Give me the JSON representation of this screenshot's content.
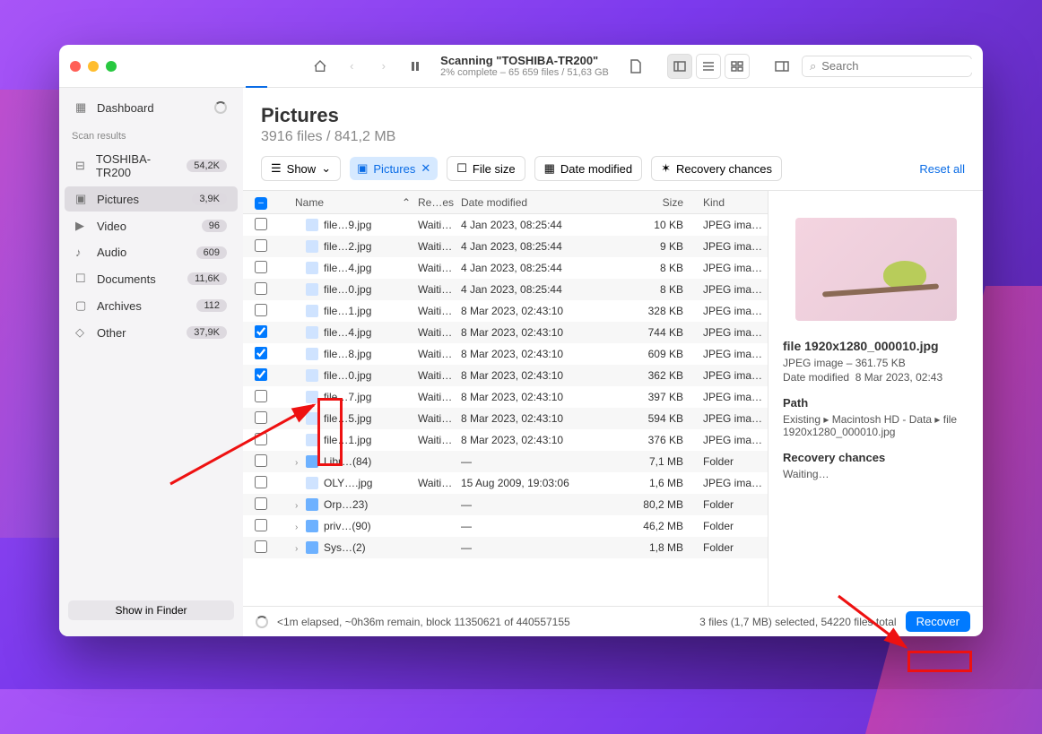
{
  "titlebar": {
    "scan_title": "Scanning \"TOSHIBA-TR200\"",
    "scan_sub": "2% complete – 65 659 files / 51,63 GB",
    "search_placeholder": "Search"
  },
  "sidebar": {
    "dashboard": "Dashboard",
    "section": "Scan results",
    "items": [
      {
        "label": "TOSHIBA-TR200",
        "count": "54,2K"
      },
      {
        "label": "Pictures",
        "count": "3,9K"
      },
      {
        "label": "Video",
        "count": "96"
      },
      {
        "label": "Audio",
        "count": "609"
      },
      {
        "label": "Documents",
        "count": "11,6K"
      },
      {
        "label": "Archives",
        "count": "112"
      },
      {
        "label": "Other",
        "count": "37,9K"
      }
    ],
    "show_in_finder": "Show in Finder"
  },
  "main": {
    "title": "Pictures",
    "subtitle": "3916 files / 841,2 MB",
    "show_btn": "Show",
    "filters": {
      "pictures": "Pictures",
      "file_size": "File size",
      "date_modified": "Date modified",
      "recovery_chances": "Recovery chances"
    },
    "reset": "Reset all"
  },
  "table": {
    "headers": {
      "name": "Name",
      "rec": "Re…es",
      "date": "Date modified",
      "size": "Size",
      "kind": "Kind"
    },
    "rows": [
      {
        "chk": false,
        "chev": false,
        "folder": false,
        "name": "file…9.jpg",
        "rec": "Waiti…",
        "date": "4 Jan 2023, 08:25:44",
        "size": "10 KB",
        "kind": "JPEG ima…"
      },
      {
        "chk": false,
        "chev": false,
        "folder": false,
        "name": "file…2.jpg",
        "rec": "Waiti…",
        "date": "4 Jan 2023, 08:25:44",
        "size": "9 KB",
        "kind": "JPEG ima…"
      },
      {
        "chk": false,
        "chev": false,
        "folder": false,
        "name": "file…4.jpg",
        "rec": "Waiti…",
        "date": "4 Jan 2023, 08:25:44",
        "size": "8 KB",
        "kind": "JPEG ima…"
      },
      {
        "chk": false,
        "chev": false,
        "folder": false,
        "name": "file…0.jpg",
        "rec": "Waiti…",
        "date": "4 Jan 2023, 08:25:44",
        "size": "8 KB",
        "kind": "JPEG ima…"
      },
      {
        "chk": false,
        "chev": false,
        "folder": false,
        "name": "file…1.jpg",
        "rec": "Waiti…",
        "date": "8 Mar 2023, 02:43:10",
        "size": "328 KB",
        "kind": "JPEG ima…"
      },
      {
        "chk": true,
        "chev": false,
        "folder": false,
        "name": "file…4.jpg",
        "rec": "Waiti…",
        "date": "8 Mar 2023, 02:43:10",
        "size": "744 KB",
        "kind": "JPEG ima…"
      },
      {
        "chk": true,
        "chev": false,
        "folder": false,
        "name": "file…8.jpg",
        "rec": "Waiti…",
        "date": "8 Mar 2023, 02:43:10",
        "size": "609 KB",
        "kind": "JPEG ima…"
      },
      {
        "chk": true,
        "chev": false,
        "folder": false,
        "name": "file…0.jpg",
        "rec": "Waiti…",
        "date": "8 Mar 2023, 02:43:10",
        "size": "362 KB",
        "kind": "JPEG ima…"
      },
      {
        "chk": false,
        "chev": false,
        "folder": false,
        "name": "file…7.jpg",
        "rec": "Waiti…",
        "date": "8 Mar 2023, 02:43:10",
        "size": "397 KB",
        "kind": "JPEG ima…"
      },
      {
        "chk": false,
        "chev": false,
        "folder": false,
        "name": "file…5.jpg",
        "rec": "Waiti…",
        "date": "8 Mar 2023, 02:43:10",
        "size": "594 KB",
        "kind": "JPEG ima…"
      },
      {
        "chk": false,
        "chev": false,
        "folder": false,
        "name": "file…1.jpg",
        "rec": "Waiti…",
        "date": "8 Mar 2023, 02:43:10",
        "size": "376 KB",
        "kind": "JPEG ima…"
      },
      {
        "chk": false,
        "chev": true,
        "folder": true,
        "name": "Libr…(84)",
        "rec": "",
        "date": "—",
        "size": "7,1 MB",
        "kind": "Folder"
      },
      {
        "chk": false,
        "chev": false,
        "folder": false,
        "name": "OLY….jpg",
        "rec": "Waiti…",
        "date": "15 Aug 2009, 19:03:06",
        "size": "1,6 MB",
        "kind": "JPEG ima…"
      },
      {
        "chk": false,
        "chev": true,
        "folder": true,
        "name": "Orp…23)",
        "rec": "",
        "date": "—",
        "size": "80,2 MB",
        "kind": "Folder"
      },
      {
        "chk": false,
        "chev": true,
        "folder": true,
        "name": "priv…(90)",
        "rec": "",
        "date": "—",
        "size": "46,2 MB",
        "kind": "Folder"
      },
      {
        "chk": false,
        "chev": true,
        "folder": true,
        "name": "Sys…(2)",
        "rec": "",
        "date": "—",
        "size": "1,8 MB",
        "kind": "Folder"
      }
    ]
  },
  "detail": {
    "filename": "file 1920x1280_000010.jpg",
    "type_size": "JPEG image – 361.75 KB",
    "date_label": "Date modified",
    "date_value": "8 Mar 2023, 02:43",
    "path_label": "Path",
    "path_value": "Existing ▸ Macintosh HD - Data ▸ file 1920x1280_000010.jpg",
    "chances_label": "Recovery chances",
    "chances_value": "Waiting…"
  },
  "status": {
    "elapsed": "<1m elapsed, ~0h36m remain, block 11350621 of 440557155",
    "selected": "3 files (1,7 MB) selected, 54220 files total",
    "recover": "Recover"
  }
}
